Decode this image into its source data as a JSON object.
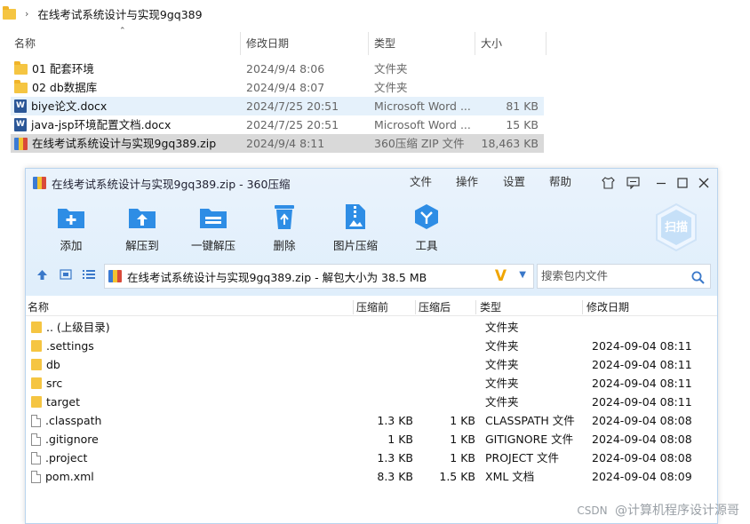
{
  "explorer": {
    "path": "在线考试系统设计与实现9gq389",
    "columns": {
      "name": "名称",
      "date": "修改日期",
      "type": "类型",
      "size": "大小"
    },
    "rows": [
      {
        "name": "01 配套环境",
        "date": "2024/9/4 8:06",
        "type": "文件夹",
        "size": "",
        "icon": "folder-icon"
      },
      {
        "name": "02 db数据库",
        "date": "2024/9/4 8:07",
        "type": "文件夹",
        "size": "",
        "icon": "folder-icon"
      },
      {
        "name": "biye论文.docx",
        "date": "2024/7/25 20:51",
        "type": "Microsoft Word ...",
        "size": "81 KB",
        "icon": "word-icon"
      },
      {
        "name": "java-jsp环境配置文档.docx",
        "date": "2024/7/25 20:51",
        "type": "Microsoft Word ...",
        "size": "15 KB",
        "icon": "word-icon"
      },
      {
        "name": "在线考试系统设计与实现9gq389.zip",
        "date": "2024/9/4 8:11",
        "type": "360压缩 ZIP 文件",
        "size": "18,463 KB",
        "icon": "zip-icon"
      }
    ]
  },
  "zipwin": {
    "title": "在线考试系统设计与实现9gq389.zip - 360压缩",
    "menu": [
      "文件",
      "操作",
      "设置",
      "帮助"
    ],
    "tools": [
      "添加",
      "解压到",
      "一键解压",
      "删除",
      "图片压缩",
      "工具"
    ],
    "scan_label": "扫描",
    "address": "在线考试系统设计与实现9gq389.zip - 解包大小为 38.5 MB",
    "address_mark": "V",
    "search_placeholder": "搜索包内文件",
    "columns": {
      "name": "名称",
      "packed_before": "压缩前",
      "packed_after": "压缩后",
      "type": "类型",
      "modified": "修改日期"
    },
    "rows": [
      {
        "name": ".. (上级目录)",
        "before": "",
        "after": "",
        "type": "文件夹",
        "modified": "",
        "icon": "folder-icon"
      },
      {
        "name": ".settings",
        "before": "",
        "after": "",
        "type": "文件夹",
        "modified": "2024-09-04 08:11",
        "icon": "folder-icon"
      },
      {
        "name": "db",
        "before": "",
        "after": "",
        "type": "文件夹",
        "modified": "2024-09-04 08:11",
        "icon": "folder-icon"
      },
      {
        "name": "src",
        "before": "",
        "after": "",
        "type": "文件夹",
        "modified": "2024-09-04 08:11",
        "icon": "folder-icon"
      },
      {
        "name": "target",
        "before": "",
        "after": "",
        "type": "文件夹",
        "modified": "2024-09-04 08:11",
        "icon": "folder-icon"
      },
      {
        "name": ".classpath",
        "before": "1.3 KB",
        "after": "1 KB",
        "type": "CLASSPATH 文件",
        "modified": "2024-09-04 08:08",
        "icon": "file-icon"
      },
      {
        "name": ".gitignore",
        "before": "1 KB",
        "after": "1 KB",
        "type": "GITIGNORE 文件",
        "modified": "2024-09-04 08:08",
        "icon": "file-icon"
      },
      {
        "name": ".project",
        "before": "1.3 KB",
        "after": "1 KB",
        "type": "PROJECT 文件",
        "modified": "2024-09-04 08:08",
        "icon": "file-icon"
      },
      {
        "name": "pom.xml",
        "before": "8.3 KB",
        "after": "1.5 KB",
        "type": "XML 文档",
        "modified": "2024-09-04 08:09",
        "icon": "file-icon"
      }
    ]
  },
  "watermark": {
    "csdn": "CSDN",
    "author": "@计算机程序设计源哥"
  },
  "colors": {
    "accent": "#2e8de5",
    "title_bg": "#eaf3fc",
    "selection": "#d9d9d9",
    "hover": "#e5f1fb"
  }
}
